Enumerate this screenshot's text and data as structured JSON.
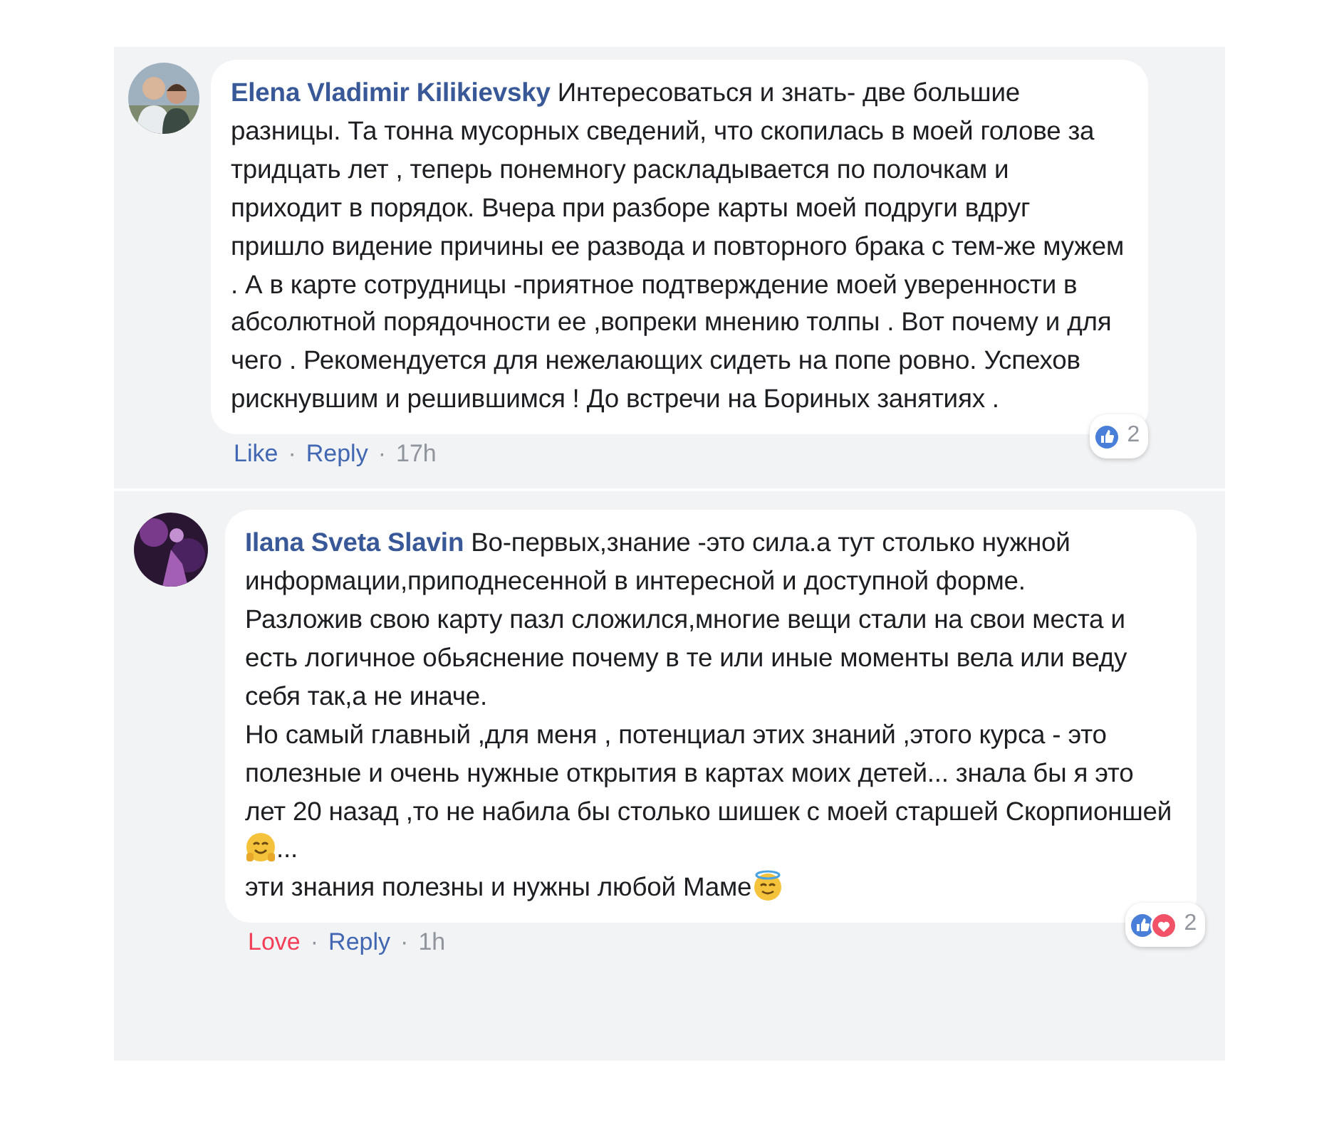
{
  "comments": [
    {
      "author": "Elena Vladimir Kilikievsky",
      "avatar": {
        "kind": "picture"
      },
      "paragraphs": [
        [
          {
            "kind": "text",
            "text": "Интересоваться и знать- две большие разницы. Та тонна мусорных сведений, что скопилась в моей голове за тридцать лет , теперь понемногу раскладывается по полочкам и приходит в порядок. Вчера при разборе карты моей подруги вдруг пришло видение причины ее развода и повторного брака с тем-же мужем . А в карте сотрудницы -приятное подтверждение моей уверенности в абсолютной порядочности ее ,вопреки мнению толпы . Вот почему и для чего . Рекомендуется для нежелающих сидеть на попе ровно. Успехов рискнувшим и решившимся ! До встречи на Бориных занятиях ."
          }
        ]
      ],
      "footer": [
        {
          "kind": "like",
          "text": "Like"
        },
        {
          "kind": "sep",
          "text": "·"
        },
        {
          "kind": "link",
          "text": "Reply"
        },
        {
          "kind": "sep",
          "text": "·"
        },
        {
          "kind": "time",
          "text": "17h"
        }
      ],
      "reactions": {
        "icons": [
          {
            "kind": "like"
          }
        ],
        "count": "2"
      }
    },
    {
      "author": "Ilana Sveta Slavin",
      "avatar": {
        "kind": "picture"
      },
      "paragraphs": [
        [
          {
            "kind": "text",
            "text": "Во-первых,знание -это сила.а тут столько нужной информации,приподнесенной в интересной и доступной форме."
          }
        ],
        [
          {
            "kind": "text",
            "text": "Разложив свою карту пазл сложился,многие вещи стали на свои места и есть логичное обьяснение почему в те или иные моменты вела или веду себя так,а не иначе."
          }
        ],
        [
          {
            "kind": "text",
            "text": "Но самый главный ,для меня , потенциал этих знаний ,этого курса - это полезные и очень нужные открытия в картах моих детей... знала бы я это лет 20 назад ,то не набила бы столько шишек с моей старшей Скорпионшей"
          },
          {
            "kind": "hug"
          },
          {
            "kind": "text",
            "text": "..."
          }
        ],
        [
          {
            "kind": "text",
            "text": "эти знания полезны и нужны любой Маме"
          },
          {
            "kind": "halo"
          }
        ]
      ],
      "footer": [
        {
          "kind": "love",
          "text": "Love"
        },
        {
          "kind": "sep",
          "text": "·"
        },
        {
          "kind": "link",
          "text": "Reply"
        },
        {
          "kind": "sep",
          "text": "·"
        },
        {
          "kind": "time",
          "text": "1h"
        }
      ],
      "reactions": {
        "icons": [
          {
            "kind": "like"
          },
          {
            "kind": "love"
          }
        ],
        "count": "2"
      }
    }
  ]
}
